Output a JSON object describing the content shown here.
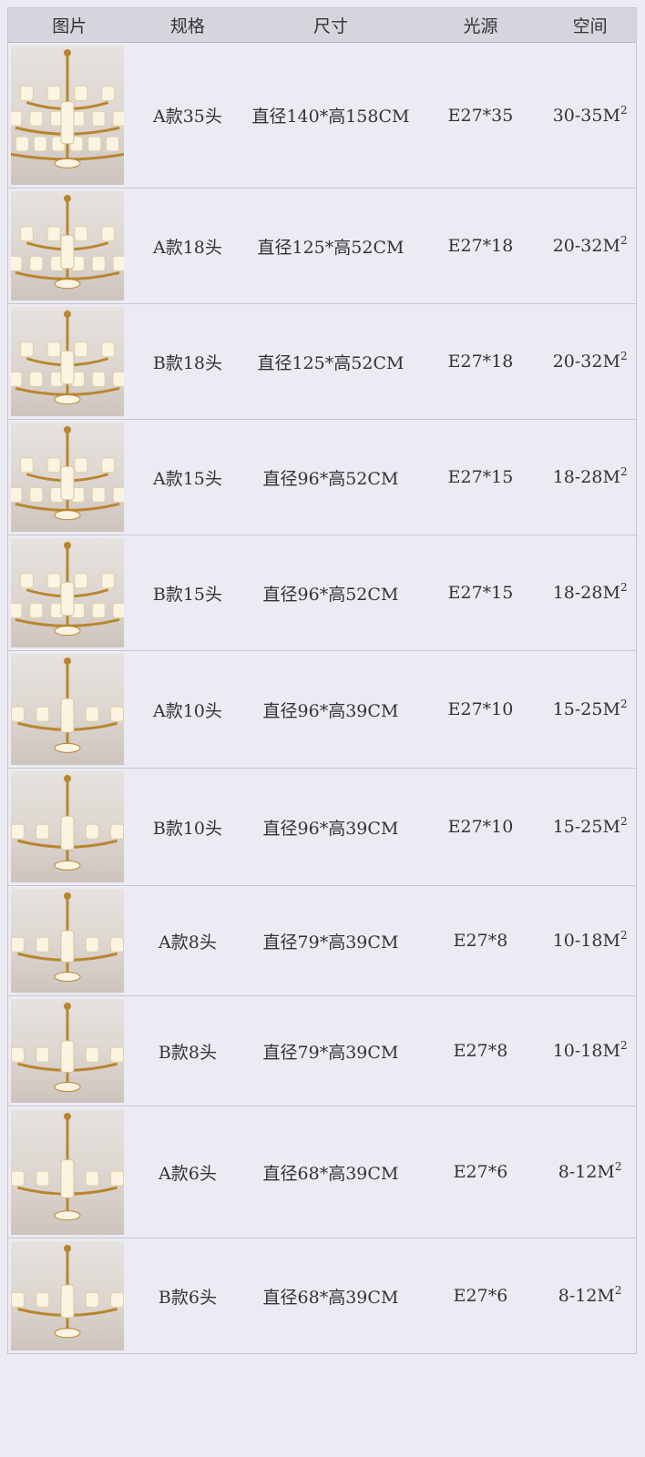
{
  "headers": {
    "image": "图片",
    "spec": "规格",
    "size": "尺寸",
    "light": "光源",
    "space": "空间"
  },
  "rows": [
    {
      "spec": "A款35头",
      "size": "直径140*高158CM",
      "light": "E27*35",
      "space": "30-35M",
      "unit_sup": "2",
      "tiers": 3
    },
    {
      "spec": "A款18头",
      "size": "直径125*高52CM",
      "light": "E27*18",
      "space": "20-32M",
      "unit_sup": "2",
      "tiers": 2
    },
    {
      "spec": "B款18头",
      "size": "直径125*高52CM",
      "light": "E27*18",
      "space": "20-32M",
      "unit_sup": "2",
      "tiers": 2
    },
    {
      "spec": "A款15头",
      "size": "直径96*高52CM",
      "light": "E27*15",
      "space": "18-28M",
      "unit_sup": "2",
      "tiers": 2
    },
    {
      "spec": "B款15头",
      "size": "直径96*高52CM",
      "light": "E27*15",
      "space": "18-28M",
      "unit_sup": "2",
      "tiers": 2
    },
    {
      "spec": "A款10头",
      "size": "直径96*高39CM",
      "light": "E27*10",
      "space": "15-25M",
      "unit_sup": "2",
      "tiers": 1
    },
    {
      "spec": "B款10头",
      "size": "直径96*高39CM",
      "light": "E27*10",
      "space": "15-25M",
      "unit_sup": "2",
      "tiers": 1
    },
    {
      "spec": "A款8头",
      "size": "直径79*高39CM",
      "light": "E27*8",
      "space": "10-18M",
      "unit_sup": "2",
      "tiers": 1
    },
    {
      "spec": "B款8头",
      "size": "直径79*高39CM",
      "light": "E27*8",
      "space": "10-18M",
      "unit_sup": "2",
      "tiers": 1
    },
    {
      "spec": "A款6头",
      "size": "直径68*高39CM",
      "light": "E27*6",
      "space": "8-12M",
      "unit_sup": "2",
      "tiers": 1
    },
    {
      "spec": "B款6头",
      "size": "直径68*高39CM",
      "light": "E27*6",
      "space": "8-12M",
      "unit_sup": "2",
      "tiers": 1
    }
  ],
  "colors": {
    "background": "#ecebf3",
    "header_bg": "#d6d5dd",
    "gold": "#b8862f",
    "shade": "#fbf4e2"
  }
}
